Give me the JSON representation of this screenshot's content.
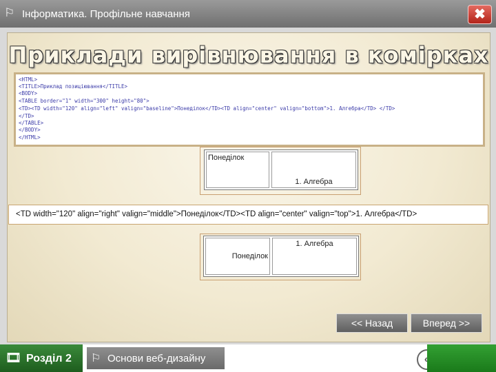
{
  "window": {
    "icon": "flag-icon",
    "title": "Інформатика. Профільне навчання",
    "close_label": "✖"
  },
  "slide": {
    "heading": "Приклади вирівнювання в комірках",
    "code_lines": [
      "<HTML>",
      "<TITLE>Приклад позиціювання</TITLE>",
      "<BODY>",
      "<TABLE border=\"1\" width=\"300\" height=\"80\">",
      "<TD><TD width=\"120\" align=\"left\" valign=\"baseline\">Понеділок</TD><TD align=\"center\" valign=\"bottom\">1. Алгебра</TD> </TD>",
      "</TD>",
      "</TABLE>",
      "</BODY>",
      "</HTML>"
    ],
    "example1": {
      "cell1": "Понеділок",
      "cell2": "1. Алгебра"
    },
    "description": "<TD width=\"120\" align=\"right\" valign=\"middle\">Понеділок</TD><TD align=\"center\" valign=\"top\">1. Алгебра</TD>",
    "example2": {
      "cell1": "Понеділок",
      "cell2": "1. Алгебра"
    }
  },
  "nav": {
    "back_label": "<< Назад",
    "forward_label": "Вперед >>"
  },
  "footer": {
    "section_icon": "film-icon",
    "section_label": "Розділ 2",
    "topic_icon": "flag-icon",
    "topic_label": "Основи веб-дизайну",
    "back_icon": "chevron-left-icon",
    "back_symbol": "«"
  }
}
